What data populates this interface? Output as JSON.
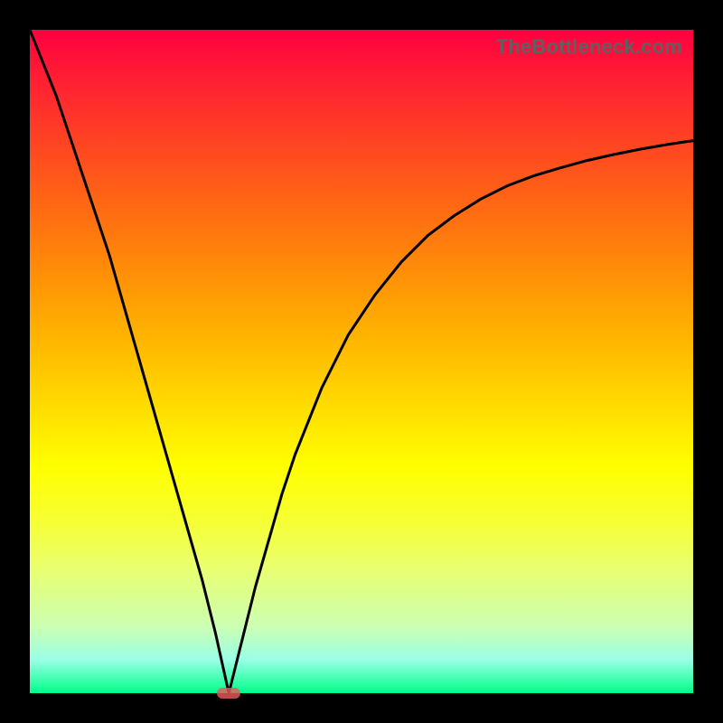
{
  "watermark": "TheBottleneck.com",
  "chart_data": {
    "type": "line",
    "title": "",
    "xlabel": "",
    "ylabel": "",
    "xlim": [
      0,
      100
    ],
    "ylim": [
      0,
      100
    ],
    "grid": false,
    "notch": {
      "x": 30,
      "y": 0
    },
    "marker": {
      "x": 30,
      "y": 0,
      "color": "#e65a5a"
    },
    "series": [
      {
        "name": "curve",
        "color": "#000000",
        "x": [
          0,
          2,
          4,
          6,
          8,
          10,
          12,
          14,
          16,
          18,
          20,
          22,
          24,
          26,
          28,
          30,
          32,
          34,
          36,
          38,
          40,
          44,
          48,
          52,
          56,
          60,
          64,
          68,
          72,
          76,
          80,
          84,
          88,
          92,
          96,
          100
        ],
        "values": [
          100,
          95,
          90,
          84,
          78,
          72,
          66,
          59,
          52,
          45,
          38,
          31,
          24,
          17,
          9,
          0,
          8,
          16,
          23,
          30,
          36,
          46,
          54,
          60,
          65,
          69,
          72,
          74.5,
          76.5,
          78,
          79.2,
          80.3,
          81.2,
          82,
          82.7,
          83.3
        ]
      }
    ],
    "background_gradient": {
      "top": "#ff0040",
      "bottom": "#00ff88"
    }
  }
}
